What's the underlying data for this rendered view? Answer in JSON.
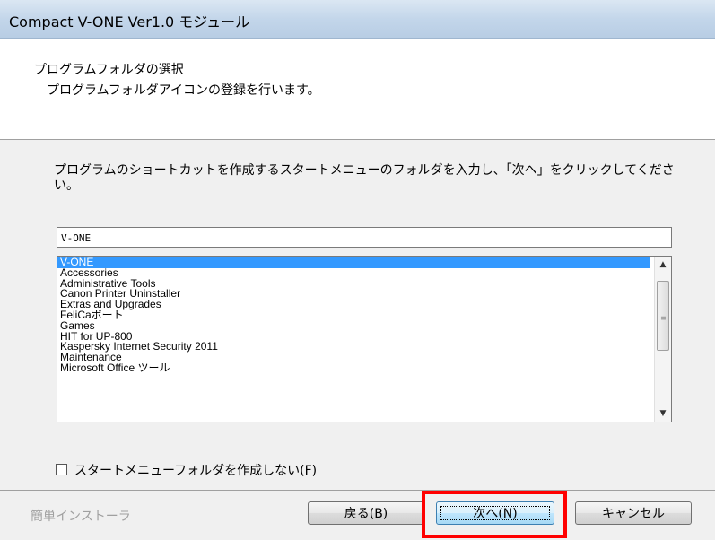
{
  "window": {
    "title": "Compact V-ONE Ver1.0 モジュール"
  },
  "header": {
    "title": "プログラムフォルダの選択",
    "subtitle": "プログラムフォルダアイコンの登録を行います。"
  },
  "body": {
    "description": "プログラムのショートカットを作成するスタートメニューのフォルダを入力し、「次へ」をクリックしてください。",
    "folder_input_value": "V-ONE",
    "folder_list": [
      "V-ONE",
      "Accessories",
      "Administrative Tools",
      "Canon Printer Uninstaller",
      "Extras and Upgrades",
      "FeliCaポート",
      "Games",
      "HIT for UP-800",
      "Kaspersky Internet Security 2011",
      "Maintenance",
      "Microsoft Office ツール"
    ],
    "selected_item": "V-ONE",
    "checkbox_label": "スタートメニューフォルダを作成しない(F)",
    "checkbox_checked": false
  },
  "footer": {
    "label": "簡単インストーラ",
    "back_label": "戻る(B)",
    "next_label": "次へ(N)",
    "cancel_label": "キャンセル"
  },
  "colors": {
    "selection": "#3399ff",
    "highlight_box": "#ff0000"
  }
}
